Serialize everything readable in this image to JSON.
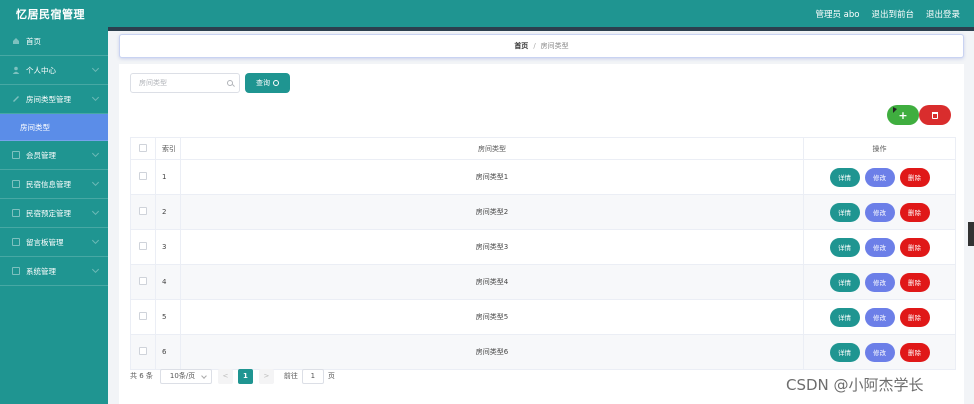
{
  "header": {
    "brand": "忆居民宿管理",
    "admin": "管理员 abo",
    "to_front": "退出到前台",
    "logout": "退出登录"
  },
  "sidebar": {
    "items": [
      {
        "label": "首页",
        "icon": "home-icon"
      },
      {
        "label": "个人中心",
        "icon": "user-icon"
      },
      {
        "label": "房间类型管理",
        "icon": "folder-icon"
      },
      {
        "label": "会员管理",
        "icon": "member-icon"
      },
      {
        "label": "民宿信息管理",
        "icon": "info-icon"
      },
      {
        "label": "民宿预定管理",
        "icon": "booking-icon"
      },
      {
        "label": "留言板管理",
        "icon": "message-icon"
      },
      {
        "label": "系统管理",
        "icon": "settings-icon"
      }
    ],
    "active_sub": "房间类型"
  },
  "breadcrumb": {
    "home": "首页",
    "separator": "/",
    "current": "房间类型"
  },
  "search": {
    "placeholder": "房间类型",
    "button": "查询"
  },
  "actions": {
    "add": "+"
  },
  "table": {
    "headers": {
      "index": "索引",
      "type": "房间类型",
      "operation": "操作"
    },
    "rows": [
      {
        "index": "1",
        "type": "房间类型1"
      },
      {
        "index": "2",
        "type": "房间类型2"
      },
      {
        "index": "3",
        "type": "房间类型3"
      },
      {
        "index": "4",
        "type": "房间类型4"
      },
      {
        "index": "5",
        "type": "房间类型5"
      },
      {
        "index": "6",
        "type": "房间类型6"
      }
    ],
    "op_labels": {
      "detail": "详情",
      "edit": "修改",
      "delete": "删除"
    }
  },
  "pagination": {
    "total": "共 6 条",
    "page_size": "10条/页",
    "prev": "<",
    "current_page": "1",
    "next": ">",
    "goto_label": "前往",
    "goto_value": "1",
    "page_word": "页"
  },
  "watermark": "CSDN @小阿杰学长",
  "colors": {
    "primary": "#1f9591",
    "active_sub": "#5b8de8",
    "edit": "#6c7fe8",
    "danger": "#e01818",
    "add": "#3fae3f"
  }
}
